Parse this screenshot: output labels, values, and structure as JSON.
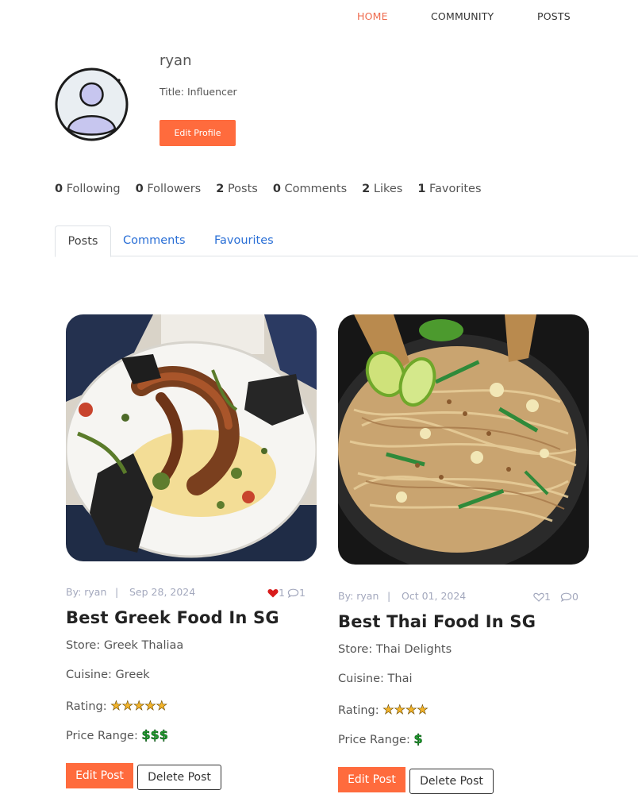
{
  "nav": {
    "home": "HOME",
    "community": "COMMUNITY",
    "posts": "POSTS"
  },
  "colors": {
    "accent": "#ff6b3d",
    "link": "#2a6fd6",
    "muted": "#a3a8bd"
  },
  "profile": {
    "username": "ryan",
    "title": "Title: Influencer",
    "edit_label": "Edit Profile",
    "avatar_icon": "user-avatar-icon"
  },
  "stats": [
    {
      "count": "0",
      "label": "Following"
    },
    {
      "count": "0",
      "label": "Followers"
    },
    {
      "count": "2",
      "label": "Posts"
    },
    {
      "count": "0",
      "label": "Comments"
    },
    {
      "count": "2",
      "label": "Likes"
    },
    {
      "count": "1",
      "label": "Favorites"
    }
  ],
  "tabs": {
    "posts": "Posts",
    "comments": "Comments",
    "favourites": "Favourites"
  },
  "posts": [
    {
      "by": "By: ryan",
      "sep": "|",
      "date": "Sep 28, 2024",
      "likes": "1",
      "liked": true,
      "comments": "1",
      "title": "Best Greek Food In SG",
      "store": "Store: Greek Thaliaa",
      "cuisine": "Cuisine: Greek",
      "rating_label": "Rating:",
      "rating": 5,
      "price_label": "Price Range:",
      "price": "$$$",
      "edit_label": "Edit Post",
      "delete_label": "Delete Post"
    },
    {
      "by": "By: ryan",
      "sep": "|",
      "date": "Oct 01, 2024",
      "likes": "1",
      "liked": false,
      "comments": "0",
      "title": "Best Thai Food In SG",
      "store": "Store: Thai Delights",
      "cuisine": "Cuisine: Thai",
      "rating_label": "Rating:",
      "rating": 4,
      "price_label": "Price Range:",
      "price": "$",
      "edit_label": "Edit Post",
      "delete_label": "Delete Post"
    }
  ]
}
